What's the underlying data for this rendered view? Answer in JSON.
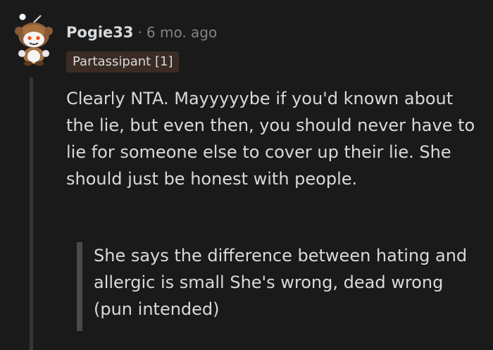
{
  "comment": {
    "username": "Pogie33",
    "separator": "·",
    "timestamp": "6 mo. ago",
    "flair": "Partassipant [1]",
    "body": "Clearly NTA. Mayyyyybe if you'd known about the lie, but even then, you should never have to lie for someone else to cover up their lie. She should just be honest with people.",
    "quote": "She says the difference between hating and allergic is small She's wrong, dead wrong (pun intended)",
    "avatar_icon": "snoo-avatar-icon"
  },
  "colors": {
    "background": "#1a1a1b",
    "text": "#d7dadc",
    "meta": "#818384",
    "flair_bg": "#3a2c24",
    "thread_line": "#343536",
    "quote_bar": "#4a4a4b"
  }
}
